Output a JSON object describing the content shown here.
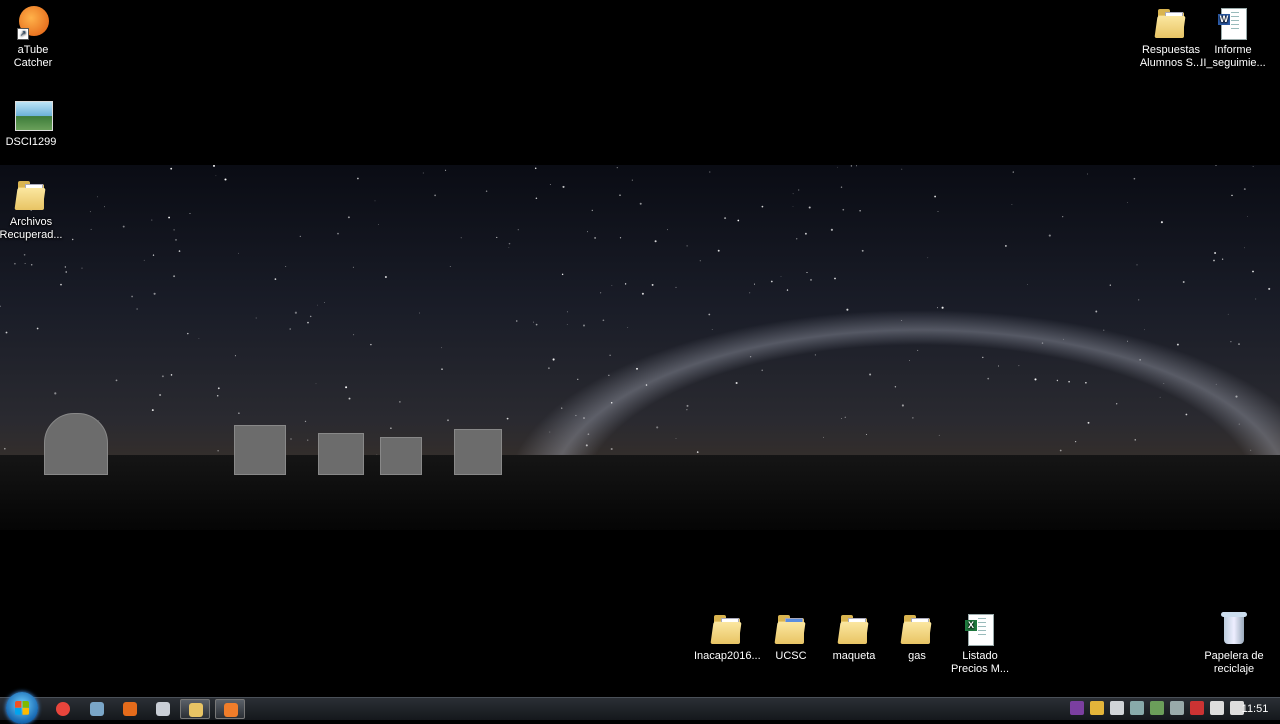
{
  "desktop": {
    "icons_left": [
      {
        "label": "aTube\nCatcher"
      },
      {
        "label": "DSCI1299"
      },
      {
        "label": "Archivos\nRecuperad..."
      }
    ],
    "icons_top_right": [
      {
        "label": "Respuestas\nAlumnos S..."
      },
      {
        "label": "Informe\nII_seguimie..."
      }
    ],
    "icons_bottom": [
      {
        "label": "Inacap2016..."
      },
      {
        "label": "UCSC"
      },
      {
        "label": "maqueta"
      },
      {
        "label": "gas"
      },
      {
        "label": "Listado\nPrecios M..."
      }
    ],
    "recycle_bin": {
      "label": "Papelera de\nreciclaje"
    }
  },
  "taskbar": {
    "start": {
      "icon": "windows-logo-icon"
    },
    "pinned": [
      {
        "icon": "chrome-icon",
        "color": "#e8453c"
      },
      {
        "icon": "app-icon",
        "color": "#7aa6c8"
      },
      {
        "icon": "matlab-icon",
        "color": "#e46b1b"
      },
      {
        "icon": "user-app-icon",
        "color": "#c9ced6"
      },
      {
        "icon": "file-explorer-icon",
        "color": "#e8c464",
        "active": true
      },
      {
        "icon": "atube-catcher-icon",
        "color": "#f07d2a",
        "active": true
      }
    ],
    "tray": [
      {
        "icon": "tray-shield-icon",
        "color": "#7b3fa0"
      },
      {
        "icon": "tray-people-icon",
        "color": "#e3b43a"
      },
      {
        "icon": "volume-icon",
        "color": "#d0d4d8"
      },
      {
        "icon": "tray-app-icon",
        "color": "#8aa"
      },
      {
        "icon": "network-icon",
        "color": "#6b9e5a"
      },
      {
        "icon": "ucsc-tray-icon",
        "color": "#9aa"
      },
      {
        "icon": "flag-icon",
        "color": "#c33"
      },
      {
        "icon": "battery-icon",
        "color": "#ddd"
      },
      {
        "icon": "signal-icon",
        "color": "#ddd"
      }
    ],
    "clock": "11:51"
  }
}
